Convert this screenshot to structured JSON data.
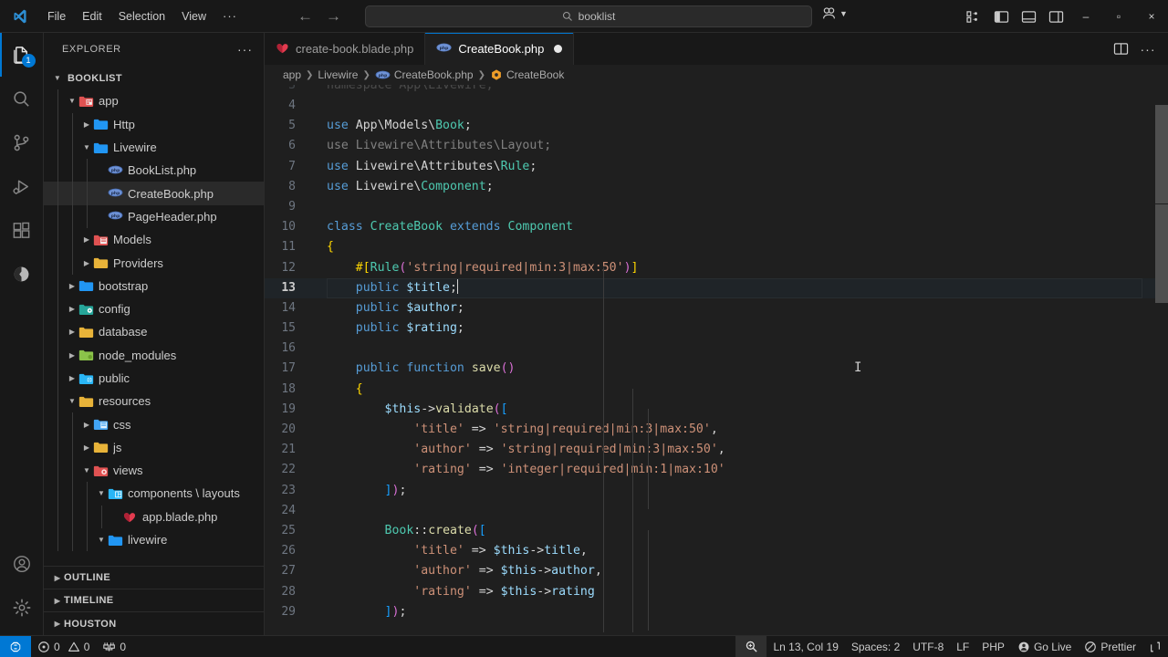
{
  "titlebar": {
    "logo_icon": "vscode-logo-icon",
    "menu": [
      "File",
      "Edit",
      "Selection",
      "View"
    ],
    "menu_more": "···",
    "nav_back_icon": "arrow-left-icon",
    "nav_forward_icon": "arrow-right-icon",
    "search": {
      "icon": "search-icon",
      "value": "booklist"
    },
    "remote_icon": "remote-account-icon",
    "remote_chevron": "chevron-down-icon",
    "layout_buttons": [
      "customize-layout-icon",
      "toggle-primary-sidebar-icon",
      "toggle-panel-icon",
      "toggle-secondary-sidebar-icon"
    ],
    "window_controls": {
      "minimize": "–",
      "maximize": "▫",
      "close": "×"
    }
  },
  "activitybar": {
    "items": [
      {
        "name": "explorer",
        "icon": "files-icon",
        "active": true,
        "badge": "1"
      },
      {
        "name": "search",
        "icon": "search-icon",
        "active": false,
        "badge": ""
      },
      {
        "name": "source-control",
        "icon": "source-control-icon",
        "active": false,
        "badge": ""
      },
      {
        "name": "run-and-debug",
        "icon": "run-debug-icon",
        "active": false,
        "badge": ""
      },
      {
        "name": "extensions",
        "icon": "extensions-icon",
        "active": false,
        "badge": ""
      },
      {
        "name": "database",
        "icon": "database-client-icon",
        "active": false,
        "badge": ""
      }
    ],
    "bottom": [
      {
        "name": "accounts",
        "icon": "account-icon"
      },
      {
        "name": "manage",
        "icon": "gear-icon"
      }
    ]
  },
  "sidebar": {
    "header_title": "EXPLORER",
    "header_more_icon": "ellipsis-icon",
    "tree": [
      {
        "label": "BOOKLIST",
        "depth": 0,
        "kind": "root",
        "state": "open",
        "icon": "none"
      },
      {
        "label": "app",
        "depth": 1,
        "kind": "folder",
        "state": "open",
        "icon": "folder-app"
      },
      {
        "label": "Http",
        "depth": 2,
        "kind": "folder",
        "state": "closed",
        "icon": "folder-blue"
      },
      {
        "label": "Livewire",
        "depth": 2,
        "kind": "folder",
        "state": "open",
        "icon": "folder-blue"
      },
      {
        "label": "BookList.php",
        "depth": 3,
        "kind": "file",
        "state": "leaf",
        "icon": "php-icon"
      },
      {
        "label": "CreateBook.php",
        "depth": 3,
        "kind": "file",
        "state": "leaf",
        "icon": "php-icon",
        "selected": true
      },
      {
        "label": "PageHeader.php",
        "depth": 3,
        "kind": "file",
        "state": "leaf",
        "icon": "php-icon"
      },
      {
        "label": "Models",
        "depth": 2,
        "kind": "folder",
        "state": "closed",
        "icon": "folder-models"
      },
      {
        "label": "Providers",
        "depth": 2,
        "kind": "folder",
        "state": "closed",
        "icon": "folder-yellow"
      },
      {
        "label": "bootstrap",
        "depth": 1,
        "kind": "folder",
        "state": "closed",
        "icon": "folder-blue"
      },
      {
        "label": "config",
        "depth": 1,
        "kind": "folder",
        "state": "closed",
        "icon": "folder-config"
      },
      {
        "label": "database",
        "depth": 1,
        "kind": "folder",
        "state": "closed",
        "icon": "folder-yellow"
      },
      {
        "label": "node_modules",
        "depth": 1,
        "kind": "folder",
        "state": "closed",
        "icon": "folder-green"
      },
      {
        "label": "public",
        "depth": 1,
        "kind": "folder",
        "state": "closed",
        "icon": "folder-public"
      },
      {
        "label": "resources",
        "depth": 1,
        "kind": "folder",
        "state": "open",
        "icon": "folder-yellow"
      },
      {
        "label": "css",
        "depth": 2,
        "kind": "folder",
        "state": "closed",
        "icon": "folder-css"
      },
      {
        "label": "js",
        "depth": 2,
        "kind": "folder",
        "state": "closed",
        "icon": "folder-yellow"
      },
      {
        "label": "views",
        "depth": 2,
        "kind": "folder",
        "state": "open",
        "icon": "folder-views"
      },
      {
        "label": "components \\ layouts",
        "depth": 3,
        "kind": "folder",
        "state": "open",
        "icon": "folder-components"
      },
      {
        "label": "app.blade.php",
        "depth": 4,
        "kind": "file",
        "state": "leaf",
        "icon": "blade-icon"
      },
      {
        "label": "livewire",
        "depth": 3,
        "kind": "folder",
        "state": "open",
        "icon": "folder-blue"
      }
    ],
    "panels": [
      "OUTLINE",
      "TIMELINE",
      "HOUSTON"
    ]
  },
  "editor": {
    "tabs": [
      {
        "label": "create-book.blade.php",
        "icon": "blade-icon",
        "active": false,
        "dirty": false
      },
      {
        "label": "CreateBook.php",
        "icon": "php-icon",
        "active": true,
        "dirty": true
      }
    ],
    "tab_actions": [
      "split-editor-icon",
      "more-actions-icon"
    ],
    "breadcrumbs": [
      {
        "label": "app",
        "icon": ""
      },
      {
        "label": "Livewire",
        "icon": ""
      },
      {
        "label": "CreateBook.php",
        "icon": "php-icon"
      },
      {
        "label": "CreateBook",
        "icon": "class-icon"
      }
    ],
    "first_visible_line": 3,
    "lines": [
      {
        "n": 3,
        "segments": [
          {
            "t": "namespace App\\Livewire;",
            "c": "t-dim"
          }
        ],
        "clipped": true
      },
      {
        "n": 4,
        "segments": []
      },
      {
        "n": 5,
        "segments": [
          {
            "t": "use ",
            "c": "t-key"
          },
          {
            "t": "App\\Models\\",
            "c": "t-white"
          },
          {
            "t": "Book",
            "c": "t-type"
          },
          {
            "t": ";",
            "c": "t-white"
          }
        ]
      },
      {
        "n": 6,
        "segments": [
          {
            "t": "use ",
            "c": "t-dim"
          },
          {
            "t": "Livewire\\Attributes\\",
            "c": "t-dim"
          },
          {
            "t": "Layout",
            "c": "t-dim"
          },
          {
            "t": ";",
            "c": "t-dim"
          }
        ]
      },
      {
        "n": 7,
        "segments": [
          {
            "t": "use ",
            "c": "t-key"
          },
          {
            "t": "Livewire\\Attributes\\",
            "c": "t-white"
          },
          {
            "t": "Rule",
            "c": "t-type"
          },
          {
            "t": ";",
            "c": "t-white"
          }
        ]
      },
      {
        "n": 8,
        "segments": [
          {
            "t": "use ",
            "c": "t-key"
          },
          {
            "t": "Livewire\\",
            "c": "t-white"
          },
          {
            "t": "Component",
            "c": "t-type"
          },
          {
            "t": ";",
            "c": "t-white"
          }
        ]
      },
      {
        "n": 9,
        "segments": []
      },
      {
        "n": 10,
        "segments": [
          {
            "t": "class ",
            "c": "t-key"
          },
          {
            "t": "CreateBook",
            "c": "t-type"
          },
          {
            "t": " extends ",
            "c": "t-key"
          },
          {
            "t": "Component",
            "c": "t-type"
          }
        ]
      },
      {
        "n": 11,
        "segments": [
          {
            "t": "{",
            "c": "t-br1"
          }
        ]
      },
      {
        "n": 12,
        "segments": [
          {
            "t": "    ",
            "c": "t-white"
          },
          {
            "t": "#[",
            "c": "t-br1"
          },
          {
            "t": "Rule",
            "c": "t-type"
          },
          {
            "t": "(",
            "c": "t-br2"
          },
          {
            "t": "'string|required|min:3|max:50'",
            "c": "t-str"
          },
          {
            "t": ")",
            "c": "t-br2"
          },
          {
            "t": "]",
            "c": "t-br1"
          }
        ]
      },
      {
        "n": 13,
        "current": true,
        "segments": [
          {
            "t": "    ",
            "c": "t-white"
          },
          {
            "t": "public ",
            "c": "t-key"
          },
          {
            "t": "$title",
            "c": "t-var"
          },
          {
            "t": ";",
            "c": "t-white"
          }
        ],
        "cursor_after": true
      },
      {
        "n": 14,
        "segments": [
          {
            "t": "    ",
            "c": "t-white"
          },
          {
            "t": "public ",
            "c": "t-key"
          },
          {
            "t": "$author",
            "c": "t-var"
          },
          {
            "t": ";",
            "c": "t-white"
          }
        ]
      },
      {
        "n": 15,
        "segments": [
          {
            "t": "    ",
            "c": "t-white"
          },
          {
            "t": "public ",
            "c": "t-key"
          },
          {
            "t": "$rating",
            "c": "t-var"
          },
          {
            "t": ";",
            "c": "t-white"
          }
        ]
      },
      {
        "n": 16,
        "segments": []
      },
      {
        "n": 17,
        "segments": [
          {
            "t": "    ",
            "c": "t-white"
          },
          {
            "t": "public function ",
            "c": "t-key"
          },
          {
            "t": "save",
            "c": "t-fn"
          },
          {
            "t": "(",
            "c": "t-br2"
          },
          {
            "t": ")",
            "c": "t-br2"
          }
        ]
      },
      {
        "n": 18,
        "segments": [
          {
            "t": "    ",
            "c": "t-white"
          },
          {
            "t": "{",
            "c": "t-br1"
          }
        ]
      },
      {
        "n": 19,
        "segments": [
          {
            "t": "        ",
            "c": "t-white"
          },
          {
            "t": "$this",
            "c": "t-var"
          },
          {
            "t": "->",
            "c": "t-white"
          },
          {
            "t": "validate",
            "c": "t-fn"
          },
          {
            "t": "(",
            "c": "t-br2"
          },
          {
            "t": "[",
            "c": "t-br3"
          }
        ]
      },
      {
        "n": 20,
        "segments": [
          {
            "t": "            ",
            "c": "t-white"
          },
          {
            "t": "'title'",
            "c": "t-str"
          },
          {
            "t": " => ",
            "c": "t-white"
          },
          {
            "t": "'string|required|min:3|max:50'",
            "c": "t-str"
          },
          {
            "t": ",",
            "c": "t-white"
          }
        ]
      },
      {
        "n": 21,
        "segments": [
          {
            "t": "            ",
            "c": "t-white"
          },
          {
            "t": "'author'",
            "c": "t-str"
          },
          {
            "t": " => ",
            "c": "t-white"
          },
          {
            "t": "'string|required|min:3|max:50'",
            "c": "t-str"
          },
          {
            "t": ",",
            "c": "t-white"
          }
        ]
      },
      {
        "n": 22,
        "segments": [
          {
            "t": "            ",
            "c": "t-white"
          },
          {
            "t": "'rating'",
            "c": "t-str"
          },
          {
            "t": " => ",
            "c": "t-white"
          },
          {
            "t": "'integer|required|min:1|max:10'",
            "c": "t-str"
          }
        ]
      },
      {
        "n": 23,
        "segments": [
          {
            "t": "        ",
            "c": "t-white"
          },
          {
            "t": "]",
            "c": "t-br3"
          },
          {
            "t": ")",
            "c": "t-br2"
          },
          {
            "t": ";",
            "c": "t-white"
          }
        ]
      },
      {
        "n": 24,
        "segments": []
      },
      {
        "n": 25,
        "segments": [
          {
            "t": "        ",
            "c": "t-white"
          },
          {
            "t": "Book",
            "c": "t-type"
          },
          {
            "t": "::",
            "c": "t-white"
          },
          {
            "t": "create",
            "c": "t-fn"
          },
          {
            "t": "(",
            "c": "t-br2"
          },
          {
            "t": "[",
            "c": "t-br3"
          }
        ]
      },
      {
        "n": 26,
        "segments": [
          {
            "t": "            ",
            "c": "t-white"
          },
          {
            "t": "'title'",
            "c": "t-str"
          },
          {
            "t": " => ",
            "c": "t-white"
          },
          {
            "t": "$this",
            "c": "t-var"
          },
          {
            "t": "->",
            "c": "t-white"
          },
          {
            "t": "title",
            "c": "t-var"
          },
          {
            "t": ",",
            "c": "t-white"
          }
        ]
      },
      {
        "n": 27,
        "segments": [
          {
            "t": "            ",
            "c": "t-white"
          },
          {
            "t": "'author'",
            "c": "t-str"
          },
          {
            "t": " => ",
            "c": "t-white"
          },
          {
            "t": "$this",
            "c": "t-var"
          },
          {
            "t": "->",
            "c": "t-white"
          },
          {
            "t": "author",
            "c": "t-var"
          },
          {
            "t": ",",
            "c": "t-white"
          }
        ]
      },
      {
        "n": 28,
        "segments": [
          {
            "t": "            ",
            "c": "t-white"
          },
          {
            "t": "'rating'",
            "c": "t-str"
          },
          {
            "t": " => ",
            "c": "t-white"
          },
          {
            "t": "$this",
            "c": "t-var"
          },
          {
            "t": "->",
            "c": "t-white"
          },
          {
            "t": "rating",
            "c": "t-var"
          }
        ]
      },
      {
        "n": 29,
        "segments": [
          {
            "t": "        ",
            "c": "t-white"
          },
          {
            "t": "]",
            "c": "t-br3"
          },
          {
            "t": ")",
            "c": "t-br2"
          },
          {
            "t": ";",
            "c": "t-white"
          }
        ]
      }
    ]
  },
  "statusbar": {
    "remote_icon": "remote-window-icon",
    "left": [
      {
        "name": "problems-errors",
        "icon": "error-icon",
        "label": "0"
      },
      {
        "name": "problems-warnings",
        "icon": "warning-icon",
        "label": "0"
      },
      {
        "name": "ports",
        "icon": "ports-icon",
        "label": "0"
      }
    ],
    "zoom_icon": "zoom-icon",
    "right": [
      {
        "name": "editor-position",
        "icon": "",
        "label": "Ln 13, Col 19"
      },
      {
        "name": "indentation",
        "icon": "",
        "label": "Spaces: 2"
      },
      {
        "name": "encoding",
        "icon": "",
        "label": "UTF-8"
      },
      {
        "name": "eol",
        "icon": "",
        "label": "LF"
      },
      {
        "name": "language-mode",
        "icon": "",
        "label": "PHP"
      },
      {
        "name": "go-live",
        "icon": "broadcast-icon",
        "label": "Go Live"
      },
      {
        "name": "prettier",
        "icon": "prettier-icon",
        "label": "Prettier"
      },
      {
        "name": "notifications",
        "icon": "bell-icon",
        "label": ""
      }
    ]
  },
  "colors": {
    "accent": "#0078d4",
    "titlebar_bg": "#181818",
    "editor_bg": "#1f1f1f",
    "sidebar_bg": "#181818",
    "tab_active_bg": "#1f1f1f"
  }
}
